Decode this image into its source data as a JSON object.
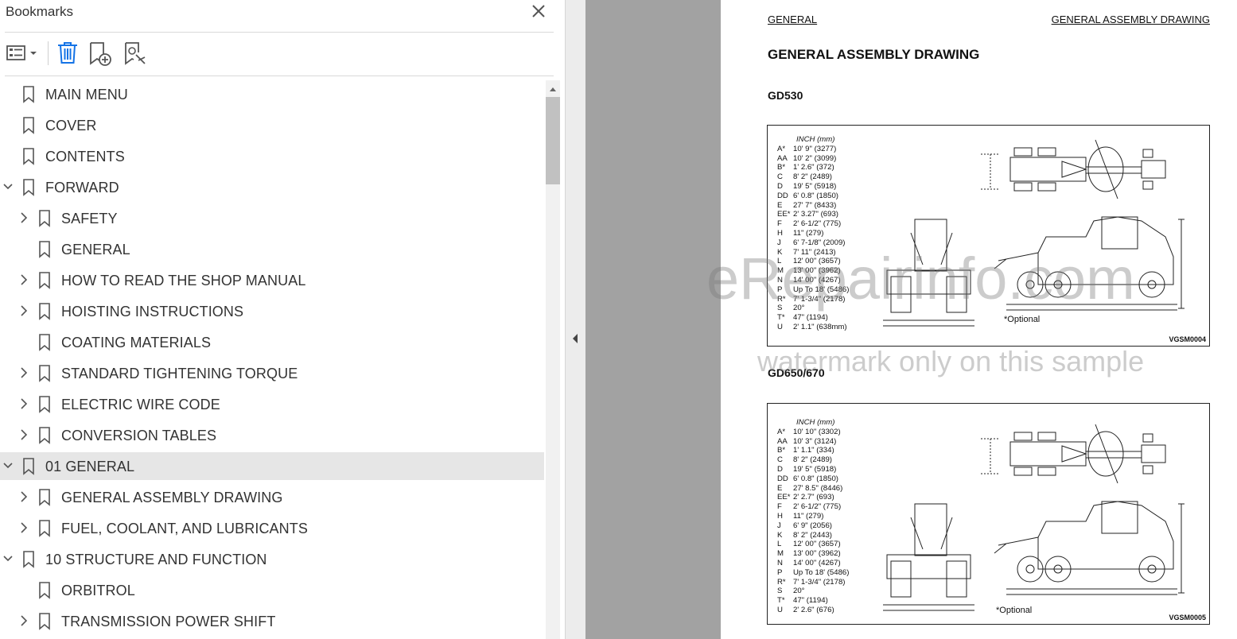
{
  "panel": {
    "title": "Bookmarks",
    "toolbar": {
      "options_icon": "list-options-icon",
      "delete_icon": "trash-icon",
      "new_bookmark_icon": "add-bookmark-icon",
      "search_bookmark_icon": "bookmark-search-icon"
    },
    "items": [
      {
        "label": "MAIN MENU",
        "level": 0,
        "chevron": "none",
        "selected": false
      },
      {
        "label": "COVER",
        "level": 0,
        "chevron": "none",
        "selected": false
      },
      {
        "label": "CONTENTS",
        "level": 0,
        "chevron": "none",
        "selected": false
      },
      {
        "label": "FORWARD",
        "level": 0,
        "chevron": "expanded",
        "selected": false
      },
      {
        "label": "SAFETY",
        "level": 1,
        "chevron": "collapsed",
        "selected": false
      },
      {
        "label": "GENERAL",
        "level": 1,
        "chevron": "none",
        "selected": false
      },
      {
        "label": "HOW TO READ THE SHOP MANUAL",
        "level": 1,
        "chevron": "collapsed",
        "selected": false
      },
      {
        "label": "HOISTING INSTRUCTIONS",
        "level": 1,
        "chevron": "collapsed",
        "selected": false
      },
      {
        "label": "COATING MATERIALS",
        "level": 1,
        "chevron": "none",
        "selected": false
      },
      {
        "label": "STANDARD TIGHTENING TORQUE",
        "level": 1,
        "chevron": "collapsed",
        "selected": false
      },
      {
        "label": "ELECTRIC WIRE CODE",
        "level": 1,
        "chevron": "collapsed",
        "selected": false
      },
      {
        "label": "CONVERSION TABLES",
        "level": 1,
        "chevron": "collapsed",
        "selected": false
      },
      {
        "label": "01 GENERAL",
        "level": 0,
        "chevron": "expanded",
        "selected": true
      },
      {
        "label": "GENERAL ASSEMBLY DRAWING",
        "level": 1,
        "chevron": "collapsed",
        "selected": false
      },
      {
        "label": "FUEL, COOLANT, AND LUBRICANTS",
        "level": 1,
        "chevron": "collapsed",
        "selected": false
      },
      {
        "label": "10 STRUCTURE AND FUNCTION",
        "level": 0,
        "chevron": "expanded",
        "selected": false
      },
      {
        "label": "ORBITROL",
        "level": 1,
        "chevron": "none",
        "selected": false
      },
      {
        "label": "TRANSMISSION POWER SHIFT",
        "level": 1,
        "chevron": "collapsed",
        "selected": false
      }
    ]
  },
  "doc": {
    "header_left": "GENERAL",
    "header_right": "GENERAL ASSEMBLY DRAWING",
    "title": "GENERAL ASSEMBLY DRAWING",
    "figures": [
      {
        "model": "GD530",
        "units": "INCH (mm)",
        "dims": [
          [
            "A*",
            "10' 9\" (3277)"
          ],
          [
            "AA",
            "10' 2\" (3099)"
          ],
          [
            "B*",
            "1' 2.6\" (372)"
          ],
          [
            "C",
            "8' 2\" (2489)"
          ],
          [
            "D",
            "19' 5\" (5918)"
          ],
          [
            "DD",
            "6' 0.8\" (1850)"
          ],
          [
            "E",
            "27' 7\" (8433)"
          ],
          [
            "EE*",
            "2' 3.27\" (693)"
          ],
          [
            "F",
            "2' 6-1/2\" (775)"
          ],
          [
            "H",
            "11\" (279)"
          ],
          [
            "J",
            "6' 7-1/8\" (2009)"
          ],
          [
            "K",
            "7' 11\" (2413)"
          ],
          [
            "L",
            "12' 00\" (3657)"
          ],
          [
            "M",
            "13' 00\" (3962)"
          ],
          [
            "N",
            "14' 00\" (4267)"
          ],
          [
            "P",
            "Up To 18' (5486)"
          ],
          [
            "R*",
            "7' 1-3/4\" (2178)"
          ],
          [
            "S",
            "20°"
          ],
          [
            "T*",
            "47\" (1194)"
          ],
          [
            "U",
            "2' 1.1\" (638mm)"
          ]
        ],
        "optional": "*Optional",
        "code": "VGSM0004"
      },
      {
        "model": "GD650/670",
        "units": "INCH (mm)",
        "dims": [
          [
            "A*",
            "10' 10\" (3302)"
          ],
          [
            "AA",
            "10' 3\" (3124)"
          ],
          [
            "B*",
            "1' 1.1\" (334)"
          ],
          [
            "C",
            "8' 2\" (2489)"
          ],
          [
            "D",
            "19' 5\" (5918)"
          ],
          [
            "DD",
            "6' 0.8\" (1850)"
          ],
          [
            "E",
            "27' 8.5\" (8446)"
          ],
          [
            "EE*",
            "2' 2.7\" (693)"
          ],
          [
            "F",
            "2' 6-1/2\" (775)"
          ],
          [
            "H",
            "11\" (279)"
          ],
          [
            "J",
            "6' 9\" (2056)"
          ],
          [
            "K",
            "8' 2\" (2443)"
          ],
          [
            "L",
            "12' 00\" (3657)"
          ],
          [
            "M",
            "13' 00\" (3962)"
          ],
          [
            "N",
            "14' 00\" (4267)"
          ],
          [
            "P",
            "Up To 18' (5486)"
          ],
          [
            "R*",
            "7' 1-3/4\" (2178)"
          ],
          [
            "S",
            "20°"
          ],
          [
            "T*",
            "47\" (1194)"
          ],
          [
            "U",
            "2' 2.6\" (676)"
          ]
        ],
        "optional": "*Optional",
        "code": "VGSM0005"
      }
    ],
    "watermark1": "eRepairinfo.com",
    "watermark2": "watermark only on this sample"
  }
}
